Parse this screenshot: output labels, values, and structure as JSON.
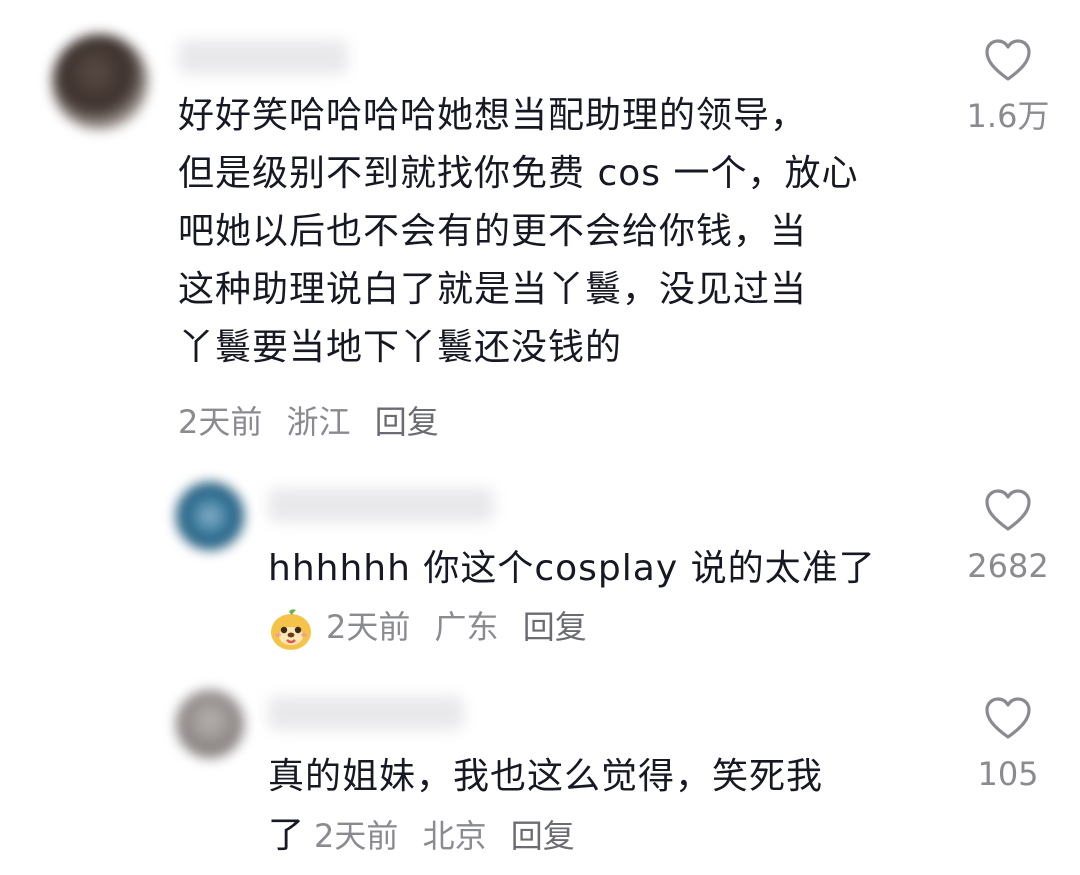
{
  "comments": [
    {
      "text_lines": [
        "好好笑哈哈哈哈她想当配助理的领导，",
        "但是级别不到就找你免费 cos 一个，放心",
        "吧她以后也不会有的更不会给你钱，当",
        "这种助理说白了就是当丫鬟，没见过当",
        "丫鬟要当地下丫鬟还没钱的"
      ],
      "time": "2天前",
      "location": "浙江",
      "reply_label": "回复",
      "likes": "1.6万",
      "like_icon": "heart-outline-icon"
    },
    {
      "text_lines": [
        "hhhhhh 你这个cosplay 说的太准了"
      ],
      "badge_icon": "dog-face-emoji-icon",
      "time": "2天前",
      "location": "广东",
      "reply_label": "回复",
      "likes": "2682",
      "like_icon": "heart-outline-icon"
    },
    {
      "text_lines": [
        "真的姐妹，我也这么觉得，笑死我",
        "了"
      ],
      "time": "2天前",
      "location": "北京",
      "reply_label": "回复",
      "likes": "105",
      "like_icon": "heart-outline-icon"
    }
  ]
}
